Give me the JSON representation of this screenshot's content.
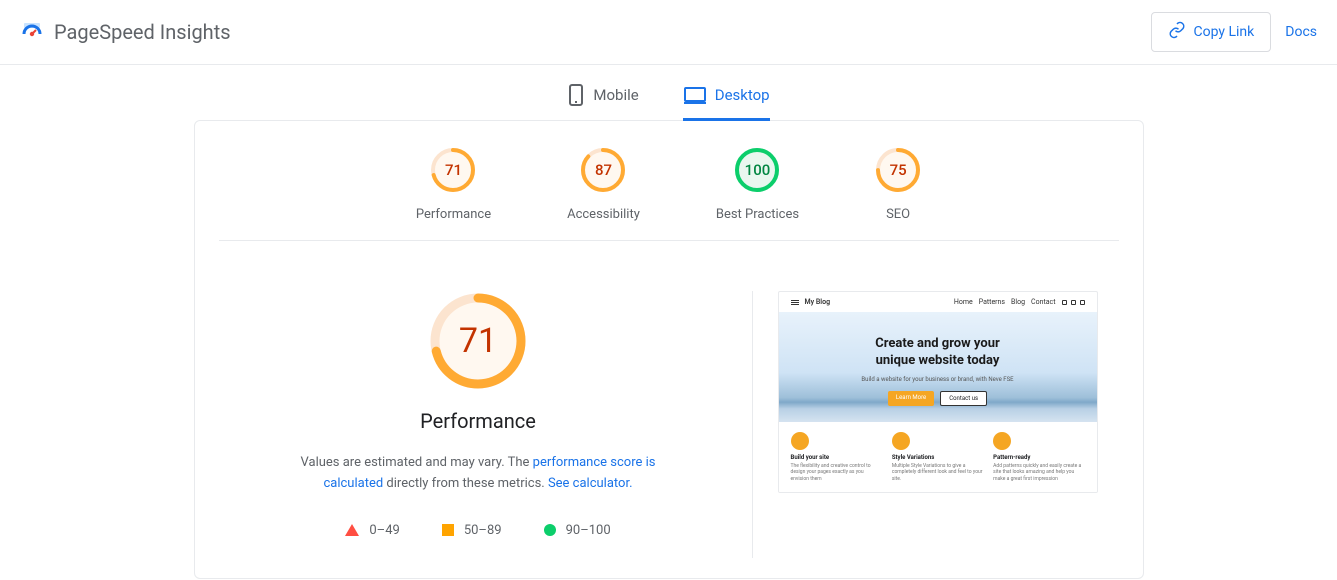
{
  "header": {
    "title": "PageSpeed Insights",
    "copy_link_label": "Copy Link",
    "docs_label": "Docs"
  },
  "tabs": {
    "mobile": "Mobile",
    "desktop": "Desktop",
    "active": "desktop"
  },
  "scores": [
    {
      "label": "Performance",
      "value": "71",
      "status": "orange"
    },
    {
      "label": "Accessibility",
      "value": "87",
      "status": "orange"
    },
    {
      "label": "Best Practices",
      "value": "100",
      "status": "green"
    },
    {
      "label": "SEO",
      "value": "75",
      "status": "orange"
    }
  ],
  "main_score": {
    "value": "71",
    "label": "Performance",
    "note_prefix": "Values are estimated and may vary. The ",
    "note_link1": "performance score is calculated",
    "note_mid": " directly from these metrics. ",
    "note_link2": "See calculator."
  },
  "legend": {
    "bad": "0–49",
    "mid": "50–89",
    "good": "90–100"
  },
  "preview": {
    "site_title": "My Blog",
    "nav": [
      "Home",
      "Patterns",
      "Blog",
      "Contact"
    ],
    "hero_line1": "Create and grow your",
    "hero_line2": "unique website today",
    "hero_sub": "Build a website for your business or brand, with Neve FSE",
    "btn_primary": "Learn More",
    "btn_secondary": "Contact us",
    "features": [
      {
        "title": "Build your site",
        "desc": "The flexibility and creative control to design your pages exactly as you envision them"
      },
      {
        "title": "Style Variations",
        "desc": "Multiple Style Variations to give a completely different look and feel to your site."
      },
      {
        "title": "Pattern-ready",
        "desc": "Add patterns quickly and easily create a site that looks amazing and help you make a great first impression"
      }
    ]
  }
}
